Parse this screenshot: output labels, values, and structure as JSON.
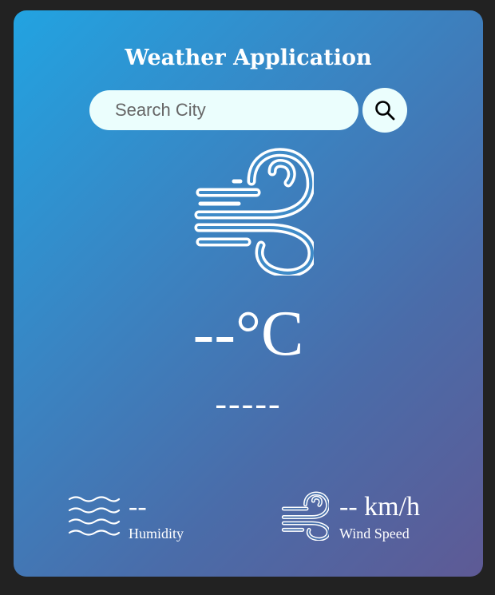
{
  "app": {
    "title": "Weather Application"
  },
  "search": {
    "placeholder": "Search City",
    "value": "",
    "button_icon": "search-icon"
  },
  "weather": {
    "icon": "wind-icon",
    "temperature": "--°C",
    "description": "-----"
  },
  "details": {
    "humidity": {
      "icon": "humidity-waves-icon",
      "value": "--",
      "label": "Humidity"
    },
    "wind": {
      "icon": "wind-icon",
      "value": "-- km/h",
      "label": "Wind Speed"
    }
  },
  "colors": {
    "page_background": "#222222",
    "card_gradient_start": "#22a3e1",
    "card_gradient_end": "#5e5a95",
    "input_background": "#ebfefd",
    "text": "#ffffff"
  }
}
